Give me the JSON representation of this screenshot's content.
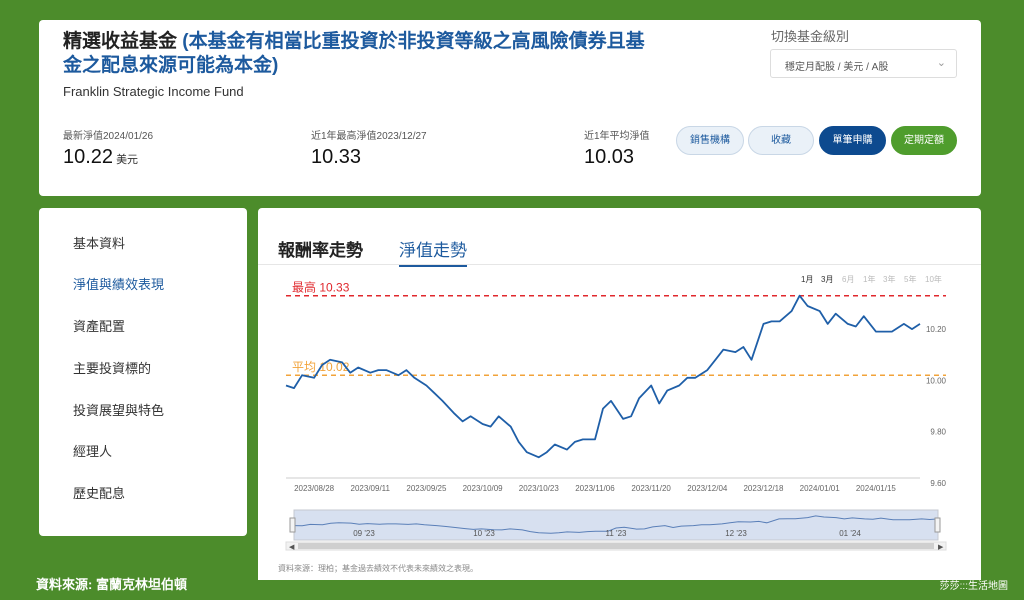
{
  "fund": {
    "title_main": "精選收益基金 ",
    "title_paren": "(本基金有相當比重投資於非投資等級之高風險債券且基金之配息來源可能為本金)",
    "name_en": "Franklin Strategic Income Fund",
    "switch_label": "切換基金級別",
    "class_selected": "穩定月配股 / 美元 / A股"
  },
  "stats": {
    "latest_label": "最新淨值2024/01/26",
    "latest_value": "10.22",
    "latest_unit": "美元",
    "high_label": "近1年最高淨值2023/12/27",
    "high_value": "10.33",
    "avg_label": "近1年平均淨值",
    "avg_value": "10.03"
  },
  "buttons": {
    "dealers": "銷售機構",
    "favorite": "收藏",
    "subscribe": "單筆申購",
    "regular": "定期定額"
  },
  "sidebar": {
    "items": [
      "基本資料",
      "淨值與績效表現",
      "資產配置",
      "主要投資標的",
      "投資展望與特色",
      "經理人",
      "歷史配息"
    ]
  },
  "tabs": {
    "returns": "報酬率走勢",
    "nav": "淨值走勢"
  },
  "ranges": [
    "1月",
    "3月",
    "6月",
    "1年",
    "3年",
    "5年",
    "10年"
  ],
  "chart_data": {
    "type": "line",
    "high_label": "最高 10.33",
    "avg_label": "平均 10.02",
    "high": 10.33,
    "avg": 10.02,
    "ylim": [
      9.6,
      10.36
    ],
    "yticks": [
      "10.20",
      "10.00",
      "9.80",
      "9.60"
    ],
    "xticks": [
      "2023/08/28",
      "2023/09/11",
      "2023/09/25",
      "2023/10/09",
      "2023/10/23",
      "2023/11/06",
      "2023/11/20",
      "2023/12/04",
      "2023/12/18",
      "2024/01/01",
      "2024/01/15"
    ],
    "navigator_labels": [
      "09 '23",
      "10 '23",
      "11 '23",
      "12 '23",
      "01 '24"
    ],
    "series": [
      {
        "color": "#1f5fa8",
        "x": [
          "2023/08/21",
          "2023/08/23",
          "2023/08/25",
          "2023/08/28",
          "2023/08/30",
          "2023/09/01",
          "2023/09/04",
          "2023/09/06",
          "2023/09/08",
          "2023/09/11",
          "2023/09/13",
          "2023/09/15",
          "2023/09/18",
          "2023/09/20",
          "2023/09/22",
          "2023/09/25",
          "2023/09/27",
          "2023/09/29",
          "2023/10/02",
          "2023/10/04",
          "2023/10/06",
          "2023/10/09",
          "2023/10/11",
          "2023/10/13",
          "2023/10/16",
          "2023/10/18",
          "2023/10/20",
          "2023/10/23",
          "2023/10/25",
          "2023/10/27",
          "2023/10/30",
          "2023/11/01",
          "2023/11/03",
          "2023/11/06",
          "2023/11/08",
          "2023/11/10",
          "2023/11/13",
          "2023/11/15",
          "2023/11/17",
          "2023/11/20",
          "2023/11/22",
          "2023/11/24",
          "2023/11/27",
          "2023/11/29",
          "2023/12/01",
          "2023/12/04",
          "2023/12/06",
          "2023/12/08",
          "2023/12/11",
          "2023/12/13",
          "2023/12/15",
          "2023/12/18",
          "2023/12/20",
          "2023/12/22",
          "2023/12/25",
          "2023/12/27",
          "2023/12/29",
          "2024/01/01",
          "2024/01/03",
          "2024/01/05",
          "2024/01/08",
          "2024/01/10",
          "2024/01/12",
          "2024/01/15",
          "2024/01/17",
          "2024/01/19",
          "2024/01/22",
          "2024/01/24",
          "2024/01/26"
        ],
        "values": [
          9.98,
          9.97,
          10.02,
          10.01,
          10.06,
          10.08,
          10.07,
          10.03,
          10.05,
          10.03,
          10.04,
          10.04,
          10.02,
          10.04,
          10.01,
          9.98,
          9.95,
          9.92,
          9.87,
          9.84,
          9.86,
          9.83,
          9.82,
          9.86,
          9.82,
          9.76,
          9.72,
          9.7,
          9.72,
          9.75,
          9.73,
          9.76,
          9.77,
          9.77,
          9.89,
          9.92,
          9.85,
          9.86,
          9.93,
          9.98,
          9.91,
          9.96,
          9.98,
          10.01,
          10.01,
          10.04,
          10.08,
          10.12,
          10.11,
          10.13,
          10.08,
          10.22,
          10.23,
          10.23,
          10.27,
          10.33,
          10.29,
          10.27,
          10.22,
          10.26,
          10.22,
          10.21,
          10.25,
          10.19,
          10.19,
          10.19,
          10.22,
          10.2,
          10.22
        ]
      }
    ]
  },
  "source_note": "資料來源：理柏；基金過去績效不代表未來績效之表現。",
  "footer": {
    "left": "資料來源: 富蘭克林坦伯頓",
    "right": "莎莎:::生活地圖"
  }
}
